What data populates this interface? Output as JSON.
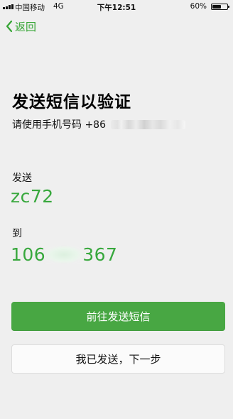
{
  "status_bar": {
    "carrier": "中国移动",
    "network": "4G",
    "time": "下午12:51",
    "battery_percent": "60%",
    "battery_level": 0.6
  },
  "navigation": {
    "back_label": "返回"
  },
  "page": {
    "title": "发送短信以验证",
    "phone_prompt": "请使用手机号码 +86",
    "send_label": "发送",
    "verification_content": "zc72",
    "target_label": "到",
    "target_number_prefix": "106",
    "target_number_suffix": "367"
  },
  "actions": {
    "send_sms_label": "前往发送短信",
    "sent_next_label": "我已发送，下一步"
  },
  "colors": {
    "accent_green": "#38a83d",
    "button_green": "#48a743",
    "background": "#efefef"
  }
}
